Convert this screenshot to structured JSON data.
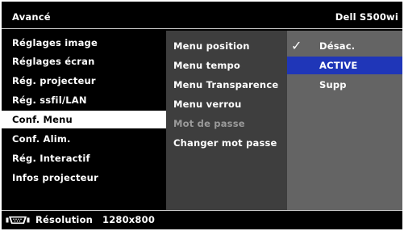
{
  "header": {
    "title": "Avancé",
    "model": "Dell S500wi"
  },
  "menu": [
    {
      "label": "Réglages image",
      "selected": false
    },
    {
      "label": "Réglages écran",
      "selected": false
    },
    {
      "label": "Rég. projecteur",
      "selected": false
    },
    {
      "label": "Rég. ssfil/LAN",
      "selected": false
    },
    {
      "label": "Conf. Menu",
      "selected": true
    },
    {
      "label": "Conf. Alim.",
      "selected": false
    },
    {
      "label": "Rég. Interactif",
      "selected": false
    },
    {
      "label": "Infos projecteur",
      "selected": false
    }
  ],
  "submenu": [
    {
      "label": "Menu position",
      "disabled": false
    },
    {
      "label": "Menu tempo",
      "disabled": false
    },
    {
      "label": "Menu Transparence",
      "disabled": false
    },
    {
      "label": "Menu verrou",
      "disabled": false
    },
    {
      "label": "Mot de passe",
      "disabled": true
    },
    {
      "label": "Changer mot passe",
      "disabled": false
    }
  ],
  "options": [
    {
      "label": "Désac.",
      "checked": true,
      "highlighted": false
    },
    {
      "label": "ACTIVE",
      "checked": false,
      "highlighted": true
    },
    {
      "label": "Supp",
      "checked": false,
      "highlighted": false
    }
  ],
  "footer": {
    "label": "Résolution",
    "value": "1280x800",
    "icon": "vga-connector-icon"
  },
  "colors": {
    "background": "#000000",
    "submenu_panel": "#3e3e3e",
    "options_panel": "#646464",
    "highlight": "#1f36b8",
    "selected_row": "#ffffff",
    "disabled_text": "#9a9a9a"
  }
}
